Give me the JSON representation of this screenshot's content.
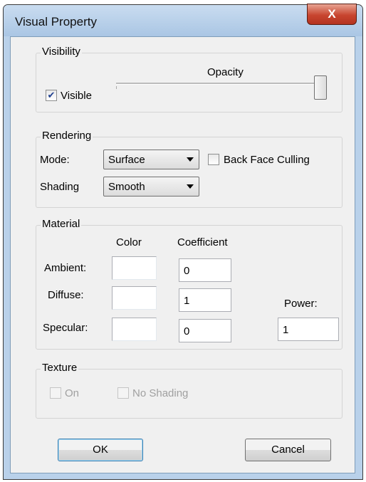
{
  "window": {
    "title": "Visual Property",
    "close_label": "X"
  },
  "visibility": {
    "title": "Visibility",
    "visible_label": "Visible",
    "visible_checked": true,
    "opacity_label": "Opacity",
    "opacity_value": 1.0
  },
  "rendering": {
    "title": "Rendering",
    "mode_label": "Mode:",
    "mode_value": "Surface",
    "back_face_label": "Back Face Culling",
    "back_face_checked": false,
    "shading_label": "Shading",
    "shading_value": "Smooth"
  },
  "material": {
    "title": "Material",
    "color_header": "Color",
    "coef_header": "Coefficient",
    "power_label": "Power:",
    "power_value": "1",
    "rows": [
      {
        "label": "Ambient:",
        "coefficient": "0",
        "color": "#ffffff"
      },
      {
        "label": "Diffuse:",
        "coefficient": "1",
        "color": "#ffffff"
      },
      {
        "label": "Specular:",
        "coefficient": "0",
        "color": "#ffffff"
      }
    ]
  },
  "texture": {
    "title": "Texture",
    "on_label": "On",
    "no_shading_label": "No Shading"
  },
  "buttons": {
    "ok": "OK",
    "cancel": "Cancel"
  }
}
